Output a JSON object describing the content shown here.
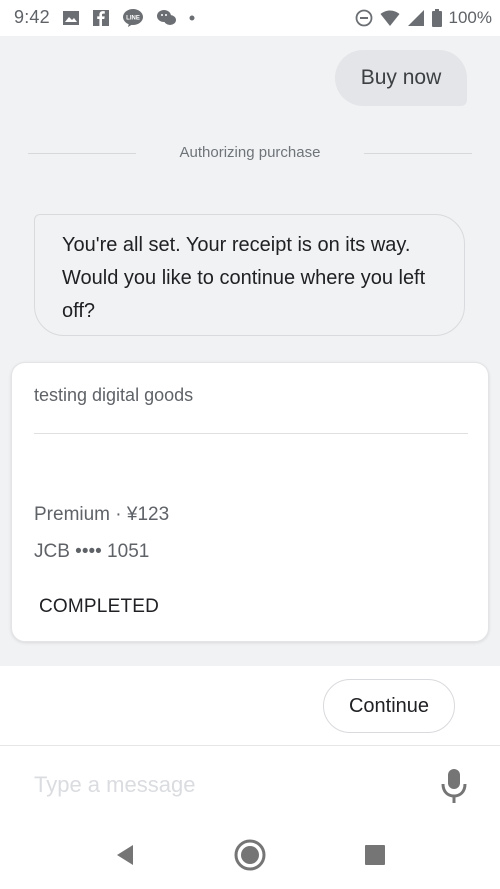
{
  "status_bar": {
    "time": "9:42",
    "battery": "100%",
    "icons_left": [
      "image-icon",
      "facebook-icon",
      "line-icon",
      "chat-icon",
      "dot-icon"
    ],
    "icons_right": [
      "do-not-disturb-icon",
      "wifi-icon",
      "signal-icon",
      "battery-icon"
    ]
  },
  "chat": {
    "user_message": "Buy now",
    "divider_text": "Authorizing purchase",
    "assistant_message": "You're all set. Your receipt is on its way. Would you like to continue where you left off?"
  },
  "card": {
    "title": "testing digital goods",
    "item": "Premium · ¥123",
    "payment": "JCB •••• 1051",
    "status": "COMPLETED"
  },
  "actions": {
    "continue_label": "Continue"
  },
  "composer": {
    "placeholder": "Type a message"
  },
  "colors": {
    "background": "#f1f2f4",
    "card": "#ffffff",
    "text": "#202124",
    "muted": "#5f6368",
    "icon": "#757575"
  }
}
